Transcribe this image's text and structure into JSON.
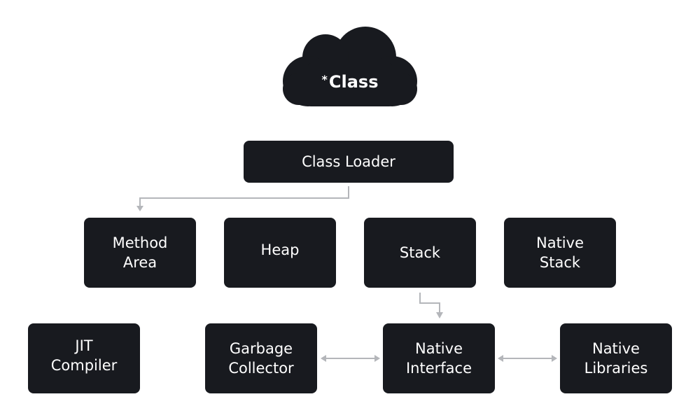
{
  "diagram": {
    "title": {
      "marker": "*",
      "label": "Class"
    },
    "colors": {
      "box": "#181a1f",
      "text": "#ffffff",
      "connector": "#b4b6ba"
    },
    "nodes": {
      "class_loader": "Class Loader",
      "method_area": "Method\nArea",
      "heap": "Heap",
      "stack": "Stack",
      "native_stack": "Native\nStack",
      "jit_compiler": "JIT\nCompiler",
      "garbage_collector": "Garbage\nCollector",
      "native_interface": "Native\nInterface",
      "native_libraries": "Native\nLibraries"
    },
    "edges": [
      {
        "from": "Class Loader",
        "to": "Method Area",
        "type": "arrow"
      },
      {
        "from": "Stack",
        "to": "Native Interface",
        "type": "arrow"
      },
      {
        "from": "Garbage Collector",
        "to": "Native Interface",
        "type": "bidirectional"
      },
      {
        "from": "Native Interface",
        "to": "Native Libraries",
        "type": "bidirectional"
      }
    ]
  }
}
